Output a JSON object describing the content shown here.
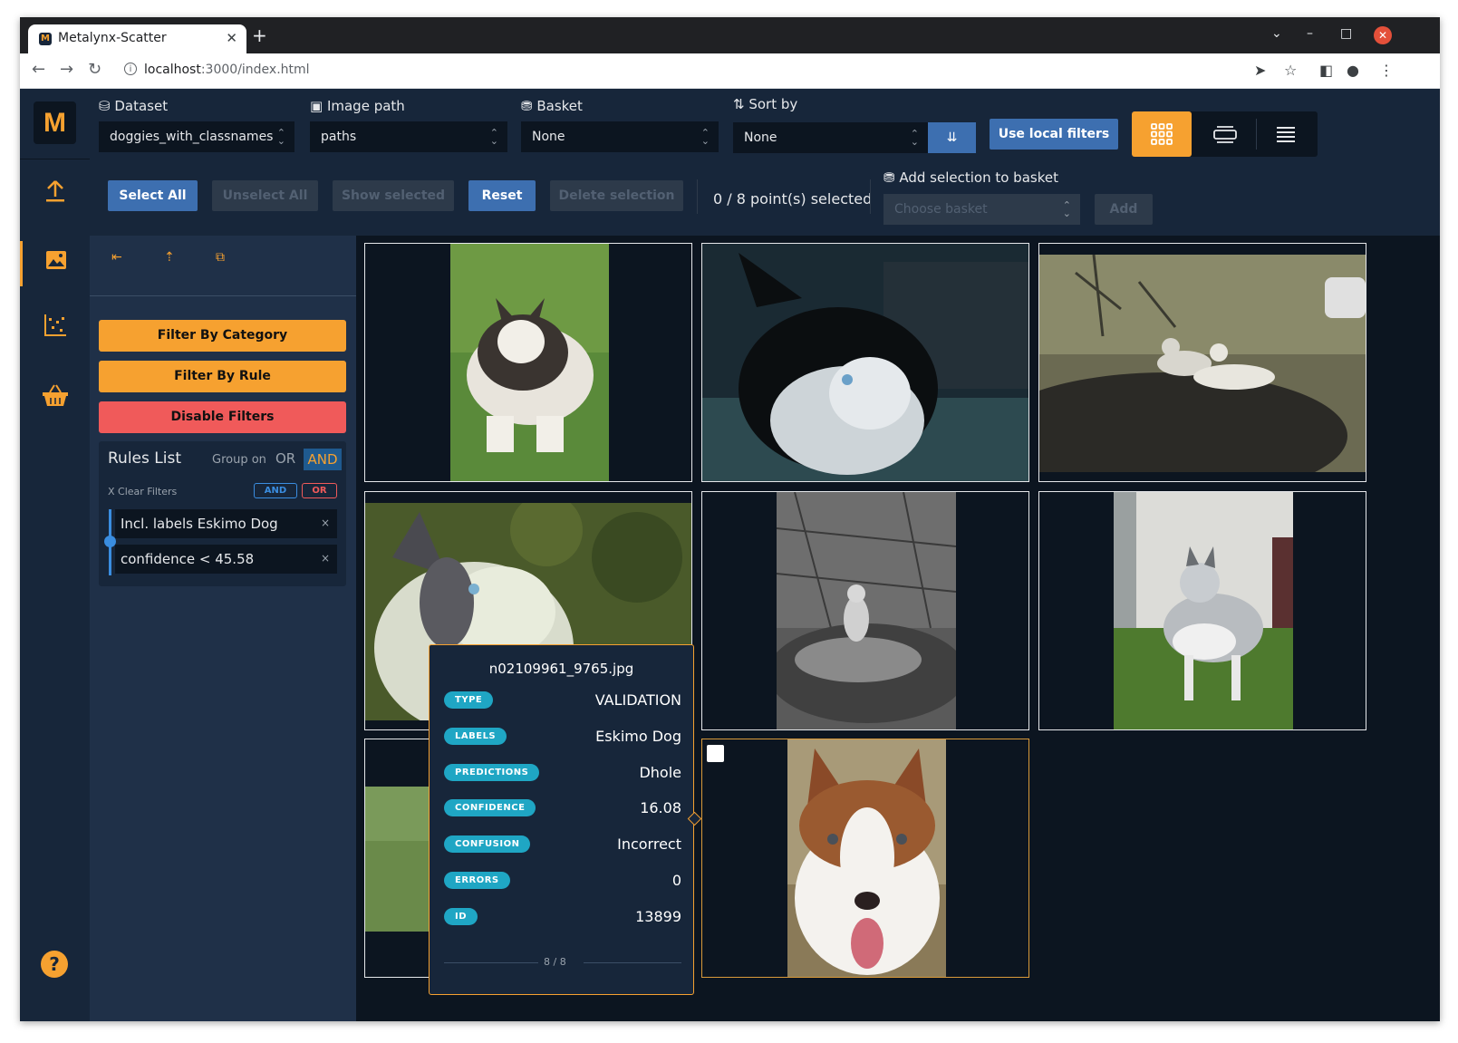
{
  "browser": {
    "tab_title": "Metalynx-Scatter",
    "tab_favicon": "M",
    "new_tab": "+",
    "url_host": "localhost",
    "url_rest": ":3000/index.html"
  },
  "app": {
    "logo": "M",
    "accent_color": "#f6a130",
    "sidebar_items": [
      "upload-icon",
      "image-icon",
      "scatter-icon",
      "basket-icon"
    ],
    "help_label": "?"
  },
  "toolbar": {
    "dataset": {
      "label": "Dataset",
      "value": "doggies_with_classnames"
    },
    "image_path": {
      "label": "Image path",
      "value": "paths"
    },
    "basket": {
      "label": "Basket",
      "value": "None"
    },
    "sort_by": {
      "label": "Sort by",
      "value": "None"
    },
    "use_local_filters": "Use local filters",
    "select_all": "Select All",
    "unselect_all": "Unselect All",
    "show_selected": "Show selected",
    "reset": "Reset",
    "delete_selection": "Delete selection",
    "selection_count": "0 / 8 point(s) selected",
    "add_to_basket_label": "Add selection to basket",
    "choose_basket_placeholder": "Choose basket",
    "add": "Add"
  },
  "filters": {
    "filter_by_category": "Filter By Category",
    "filter_by_rule": "Filter By Rule",
    "disable_filters": "Disable Filters",
    "rules_title": "Rules List",
    "group_on": "Group on",
    "group_or": "OR",
    "group_and": "AND",
    "clear_filters": "X Clear Filters",
    "chip_and": "AND",
    "chip_or": "OR",
    "rules": [
      {
        "text": "Incl. labels Eskimo Dog"
      },
      {
        "text": "confidence < 45.58"
      }
    ],
    "remove": "×"
  },
  "tooltip": {
    "filename": "n02109961_9765.jpg",
    "rows": [
      {
        "label": "TYPE",
        "value": "VALIDATION"
      },
      {
        "label": "LABELS",
        "value": "Eskimo Dog"
      },
      {
        "label": "PREDICTIONS",
        "value": "Dhole"
      },
      {
        "label": "CONFIDENCE",
        "value": "16.08"
      },
      {
        "label": "CONFUSION",
        "value": "Incorrect"
      },
      {
        "label": "ERRORS",
        "value": "0"
      },
      {
        "label": "ID",
        "value": "13899"
      }
    ],
    "pager": "8 / 8"
  }
}
